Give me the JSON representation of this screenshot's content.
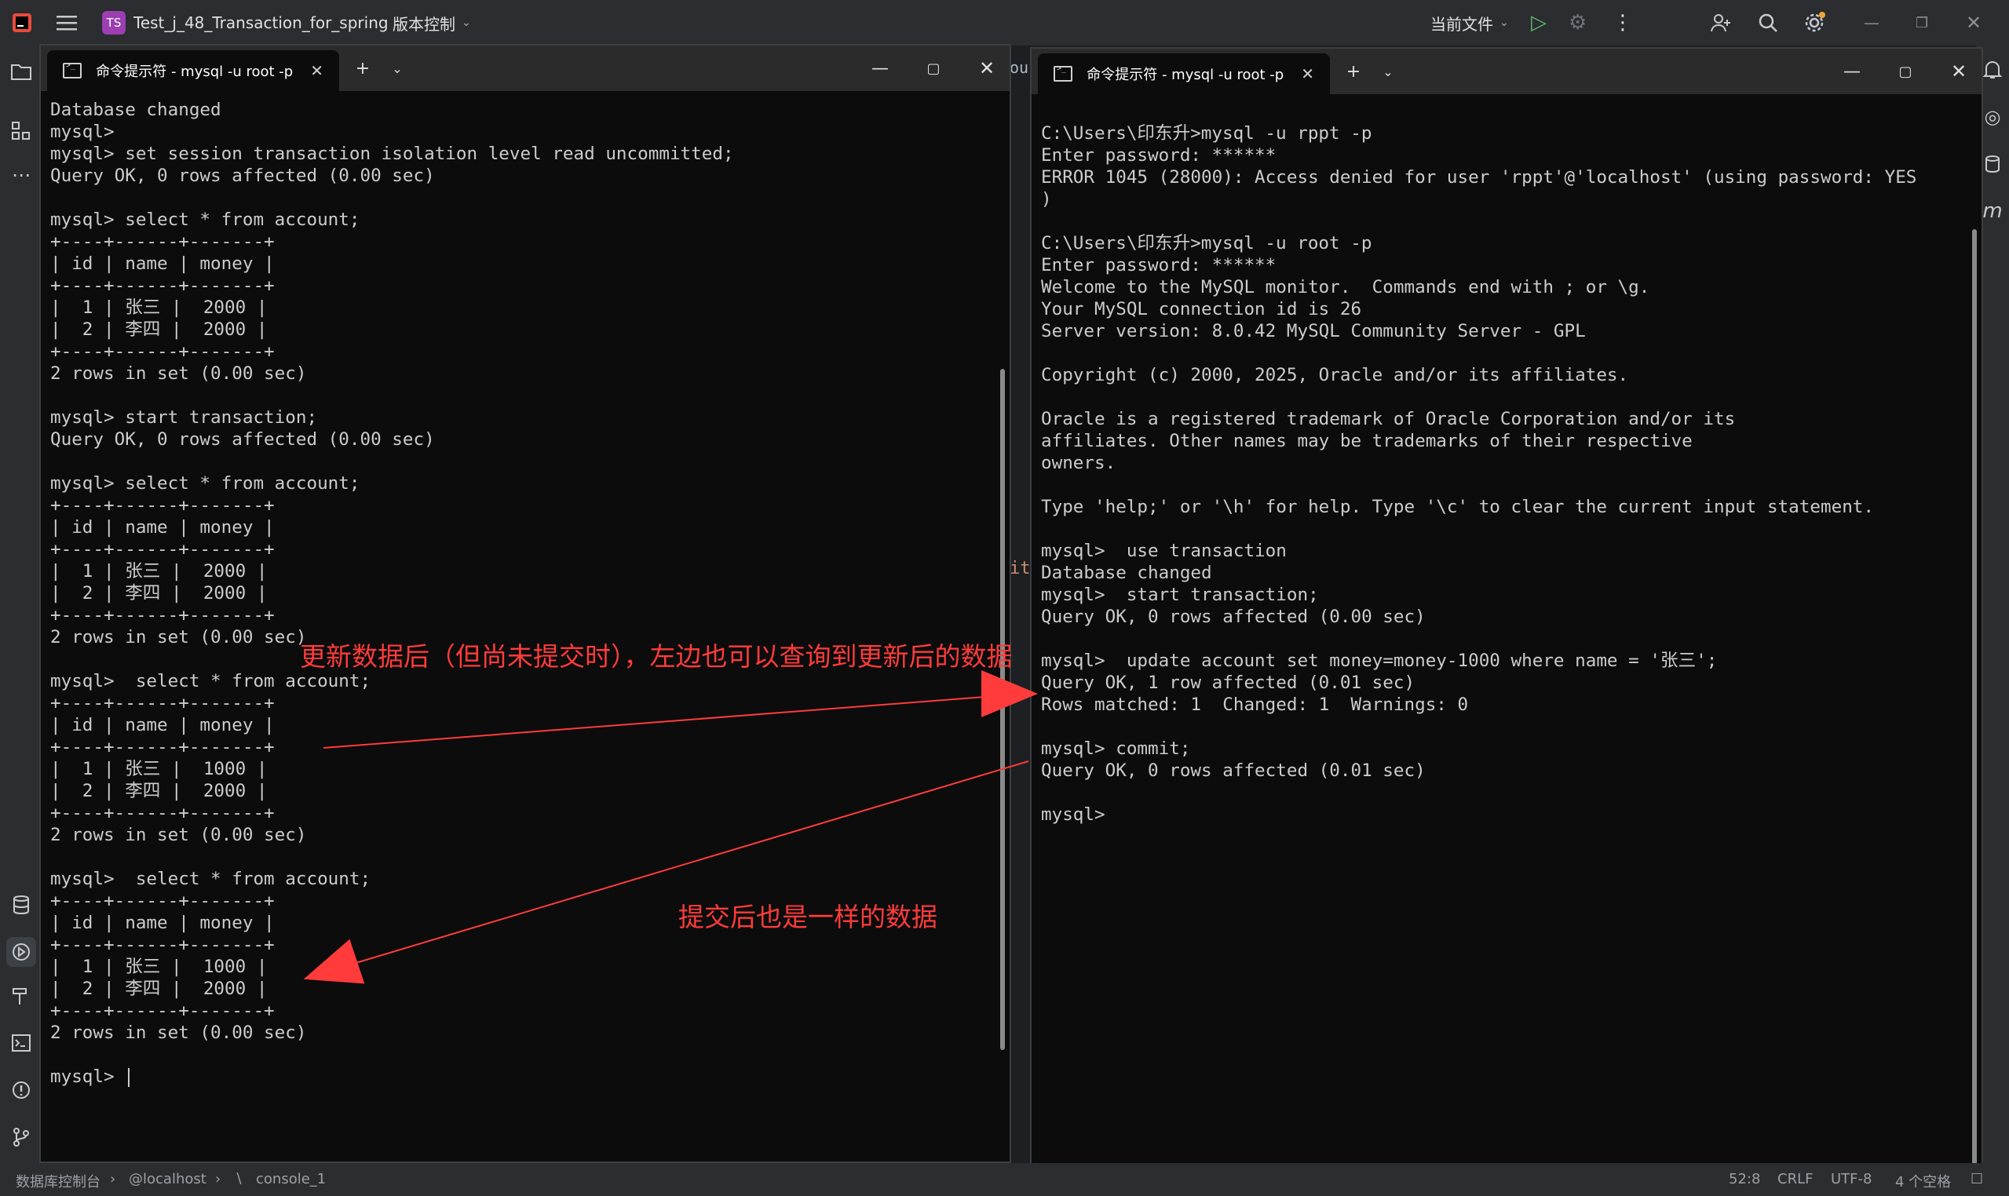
{
  "ide": {
    "project_badge": "TS",
    "project_name": "Test_j_48_Transaction_for_spring",
    "vcs_label": "版本控制",
    "run_config": "当前文件"
  },
  "status": {
    "breadcrumb_1": "数据库控制台",
    "breadcrumb_2": "@localhost",
    "breadcrumb_3": "console_1",
    "position": "52:8",
    "line_sep": "CRLF",
    "encoding": "UTF-8",
    "indent": "4 个空格",
    "bg_code_fragment": "it",
    "bg_tab_fragment": "oun"
  },
  "left_window": {
    "tab_title": "命令提示符 - mysql  -u root -p",
    "lines": [
      "Database changed",
      "mysql>",
      "mysql> set session transaction isolation level read uncommitted;",
      "Query OK, 0 rows affected (0.00 sec)",
      "",
      "mysql> select * from account;",
      "+----+------+-------+",
      "| id | name | money |",
      "+----+------+-------+",
      "|  1 | 张三 |  2000 |",
      "|  2 | 李四 |  2000 |",
      "+----+------+-------+",
      "2 rows in set (0.00 sec)",
      "",
      "mysql> start transaction;",
      "Query OK, 0 rows affected (0.00 sec)",
      "",
      "mysql> select * from account;",
      "+----+------+-------+",
      "| id | name | money |",
      "+----+------+-------+",
      "|  1 | 张三 |  2000 |",
      "|  2 | 李四 |  2000 |",
      "+----+------+-------+",
      "2 rows in set (0.00 sec)",
      "",
      "mysql>  select * from account;",
      "+----+------+-------+",
      "| id | name | money |",
      "+----+------+-------+",
      "|  1 | 张三 |  1000 |",
      "|  2 | 李四 |  2000 |",
      "+----+------+-------+",
      "2 rows in set (0.00 sec)",
      "",
      "mysql>  select * from account;",
      "+----+------+-------+",
      "| id | name | money |",
      "+----+------+-------+",
      "|  1 | 张三 |  1000 |",
      "|  2 | 李四 |  2000 |",
      "+----+------+-------+",
      "2 rows in set (0.00 sec)",
      ""
    ],
    "prompt": "mysql> "
  },
  "right_window": {
    "tab_title": "命令提示符 - mysql  -u root -p",
    "lines": [
      "C:\\Users\\印东升>mysql -u rppt -p",
      "Enter password: ******",
      "ERROR 1045 (28000): Access denied for user 'rppt'@'localhost' (using password: YES",
      ")",
      "",
      "C:\\Users\\印东升>mysql -u root -p",
      "Enter password: ******",
      "Welcome to the MySQL monitor.  Commands end with ; or \\g.",
      "Your MySQL connection id is 26",
      "Server version: 8.0.42 MySQL Community Server - GPL",
      "",
      "Copyright (c) 2000, 2025, Oracle and/or its affiliates.",
      "",
      "Oracle is a registered trademark of Oracle Corporation and/or its",
      "affiliates. Other names may be trademarks of their respective",
      "owners.",
      "",
      "Type 'help;' or '\\h' for help. Type '\\c' to clear the current input statement.",
      "",
      "mysql>  use transaction",
      "Database changed",
      "mysql>  start transaction;",
      "Query OK, 0 rows affected (0.00 sec)",
      "",
      "mysql>  update account set money=money-1000 where name = '张三';",
      "Query OK, 1 row affected (0.01 sec)",
      "Rows matched: 1  Changed: 1  Warnings: 0",
      "",
      "mysql> commit;",
      "Query OK, 0 rows affected (0.01 sec)",
      "",
      "mysql>"
    ]
  },
  "annotations": {
    "top": "更新数据后（但尚未提交时），左边也可以查询到更新后的数据",
    "bottom": "提交后也是一样的数据",
    "color": "#ff3b3b"
  }
}
